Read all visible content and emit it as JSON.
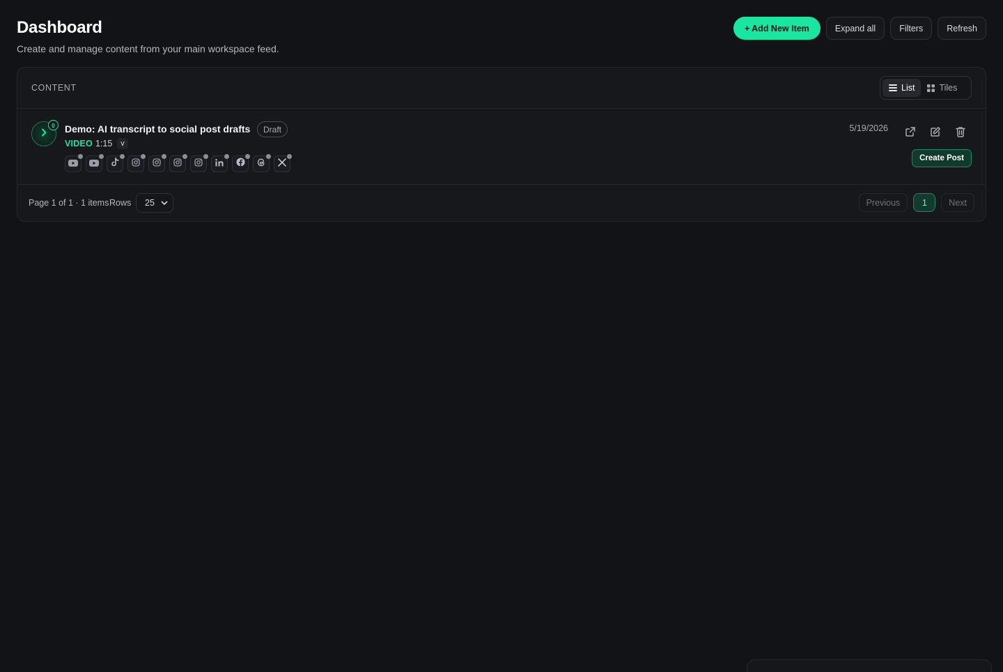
{
  "header": {
    "title": "Dashboard",
    "subtitle": "Create and manage content from your main workspace feed.",
    "actions": {
      "add_new": "+ Add New Item",
      "expand_all": "Expand all",
      "filters": "Filters",
      "refresh": "Refresh"
    }
  },
  "panel": {
    "label": "CONTENT",
    "view_toggle": {
      "list": "List",
      "tiles": "Tiles",
      "selected": "List"
    }
  },
  "items": [
    {
      "count": "0",
      "title": "Demo: AI transcript to social post drafts",
      "status": "Draft",
      "type": "VIDEO",
      "duration": "1:15",
      "chip": "v",
      "date": "5/19/2026",
      "create_post": "Create Post",
      "platforms": [
        "youtube-icon",
        "youtube-icon",
        "tiktok-icon",
        "instagram-icon",
        "instagram-icon",
        "instagram-icon",
        "instagram-icon",
        "linkedin-icon",
        "facebook-icon",
        "threads-icon",
        "x-icon"
      ]
    }
  ],
  "footer": {
    "page_info": "Page 1 of 1 · 1 items",
    "rows_label": "Rows",
    "rows_value": "25",
    "previous": "Previous",
    "current_page": "1",
    "next": "Next"
  },
  "colors": {
    "background": "#121316",
    "panel": "#17181c",
    "accent": "#19e6a0",
    "border": "#26282e"
  }
}
